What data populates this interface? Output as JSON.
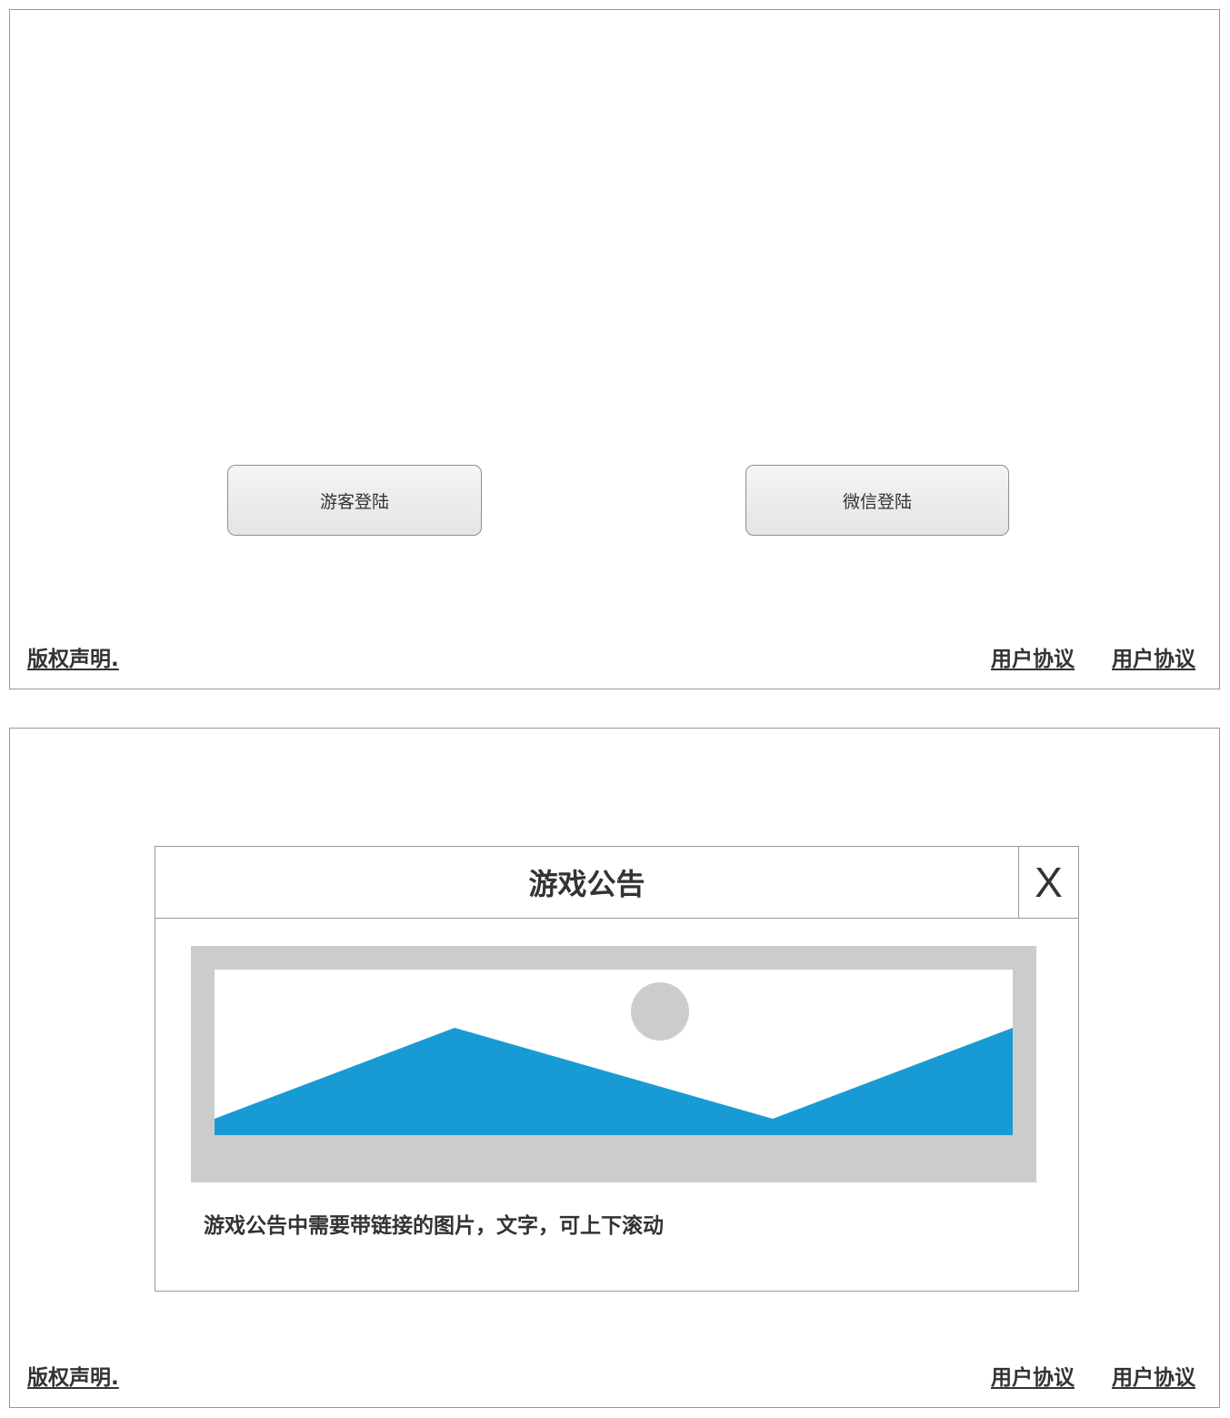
{
  "login_screen": {
    "guest_login_label": "游客登陆",
    "wechat_login_label": "微信登陆",
    "footer": {
      "copyright_label": "版权声明.",
      "user_agreement_label_1": "用户协议",
      "user_agreement_label_2": "用户协议"
    }
  },
  "notice_screen": {
    "modal": {
      "title": "游戏公告",
      "close_label": "X",
      "image_icon": "image-placeholder-icon",
      "body_text": "游戏公告中需要带链接的图片，文字，可上下滚动"
    },
    "footer": {
      "copyright_label": "版权声明.",
      "user_agreement_label_1": "用户协议",
      "user_agreement_label_2": "用户协议"
    }
  },
  "colors": {
    "border": "#999999",
    "text": "#333333",
    "placeholder_frame": "#cccccc",
    "mountain_blue": "#189bd5"
  }
}
